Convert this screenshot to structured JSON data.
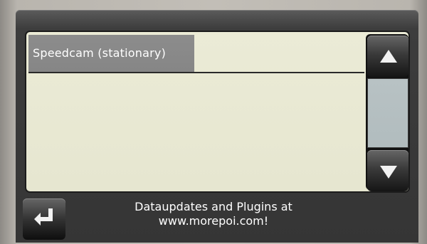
{
  "list": {
    "items": [
      {
        "label": "Speedcam (stationary)"
      }
    ]
  },
  "scrollbar": {
    "up_icon": "triangle-up",
    "down_icon": "triangle-down"
  },
  "back_button": {
    "icon": "return-arrow"
  },
  "footer": {
    "line1": "Dataupdates and Plugins at",
    "line2": "www.morepoi.com!"
  },
  "colors": {
    "frame": "#353535",
    "panel": "#e9e9d3",
    "selected_item": "#888888",
    "scroll_track": "#b5c0c2",
    "text": "#ffffff"
  }
}
